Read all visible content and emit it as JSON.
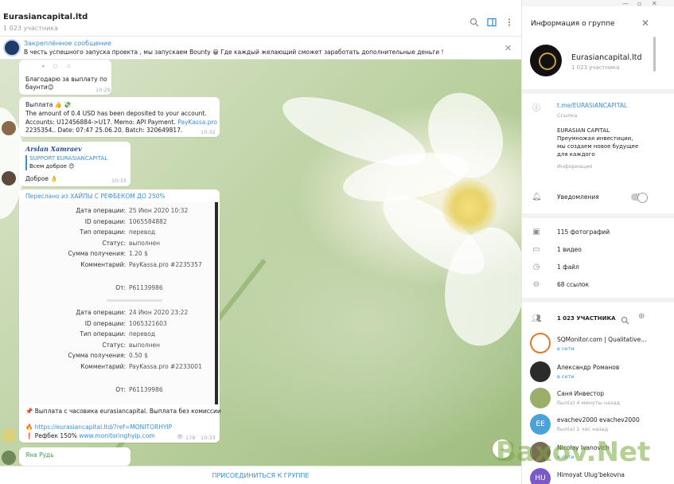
{
  "chat": {
    "title": "Eurasiancapital.ltd",
    "subtitle": "1 023 участника",
    "pinned": {
      "title": "Закреплённое сообщение",
      "text": "В честь успешного запуска проекта , мы запускаем Bounty 😀 Где каждый желающий сможет заработать дополнительные деньги !"
    },
    "messages": {
      "m1": {
        "text1": "Благодарю за выплату по",
        "text2": "баунти😊",
        "time": "10:29"
      },
      "m2": {
        "line1": "Выплата 👍 💸",
        "line2": "The amount of 0.4 USD has been deposited to your account.",
        "line3a": "Accounts: U12456884->U17. Memo: API Payment. ",
        "line3b": "PayKassa.pro",
        "line4": "2235354.. Date: 07:47 25.06.20. Batch: 320649817.",
        "time": "10:32"
      },
      "m3": {
        "sender": "Arslan Xamraev",
        "reply_title": "SUPPORT EURASIANCAPITAL",
        "reply_text": "Всем доброе 😊",
        "text": "Доброе 👌",
        "time": "10:33"
      },
      "m4": {
        "forwarded": "Переслано из ХАЙПЫ С РЕФБЕКОМ ДО 250%",
        "op1": {
          "k_date": "Дата операции:",
          "v_date": "25 Июн 2020 10:32",
          "k_id": "ID операции:",
          "v_id": "1065584882",
          "k_type": "Тип операции:",
          "v_type": "перевод",
          "k_status": "Статус:",
          "v_status": "выполнен",
          "k_sum": "Сумма получения:",
          "v_sum": "1.20 $",
          "k_comment": "Комментарий:",
          "v_comment": "PayKassa.pro #2235357",
          "k_from": "От:",
          "v_from": "P61139986"
        },
        "op2": {
          "k_date": "Дата операции:",
          "v_date": "24 Июн 2020 23:22",
          "k_id": "ID операции:",
          "v_id": "1065321603",
          "k_type": "Тип операции:",
          "v_type": "перевод",
          "k_status": "Статус:",
          "v_status": "выполнен",
          "k_sum": "Сумма получения:",
          "v_sum": "0.50 $",
          "k_comment": "Комментарий:",
          "v_comment": "PayKassa.pro #2233001",
          "k_from": "От:",
          "v_from": "P61139986"
        },
        "line1": "📌 Выплата с часовика eurasiancapital. Выплата без комиссии",
        "line2": "🔥 https://eurasiancapital.ltd/?ref=MONITORHYIP",
        "line3a": "❗ Рефбек 150% ",
        "line3b": "www.monitoringhyip.com",
        "views": "178",
        "time": "10:33"
      },
      "m5": {
        "sender": "Яна Рудь"
      }
    },
    "join_label": "ПРИСОЕДИНИТЬСЯ К ГРУППЕ"
  },
  "panel": {
    "title": "Информация о группе",
    "group_name": "Eurasiancapital.ltd",
    "group_count": "1 023 участника",
    "link": "t.me/EURASIANCAPITAL",
    "link_label": "Ссылка",
    "description": [
      "EURASIAN CAPITAL",
      "Преумножая инвестиции,",
      "мы создаем новое будущее",
      "для каждого"
    ],
    "description_label": "Информация",
    "notifications_label": "Уведомления",
    "media": {
      "photos": "115 фотографий",
      "videos": "1 видео",
      "files": "1 файл",
      "links": "68 ссылок"
    },
    "members_header": "1 023 УЧАСТНИКА",
    "members": [
      {
        "name": "SQMonitor.com | Qualitative...",
        "status": "в сети"
      },
      {
        "name": "Александр Романов",
        "status": "в сети"
      },
      {
        "name": "Саня Инвестор",
        "status": "был(а) 4 минуты назад"
      },
      {
        "name": "evachev2000 evachev2000",
        "status": "был(а) 1 час назад"
      },
      {
        "name": "Nicolay Ivanovich",
        "status": "в сети"
      },
      {
        "name": "Himoyat Ulug'bekovna",
        "status": ""
      }
    ],
    "member_initials": {
      "ee": "EE",
      "hu": "HU"
    }
  },
  "watermark": "Baxov.Net",
  "colors": {
    "accent": "#3a8fd8",
    "online": "#3a8fd8",
    "offline": "#9aa0a6"
  }
}
